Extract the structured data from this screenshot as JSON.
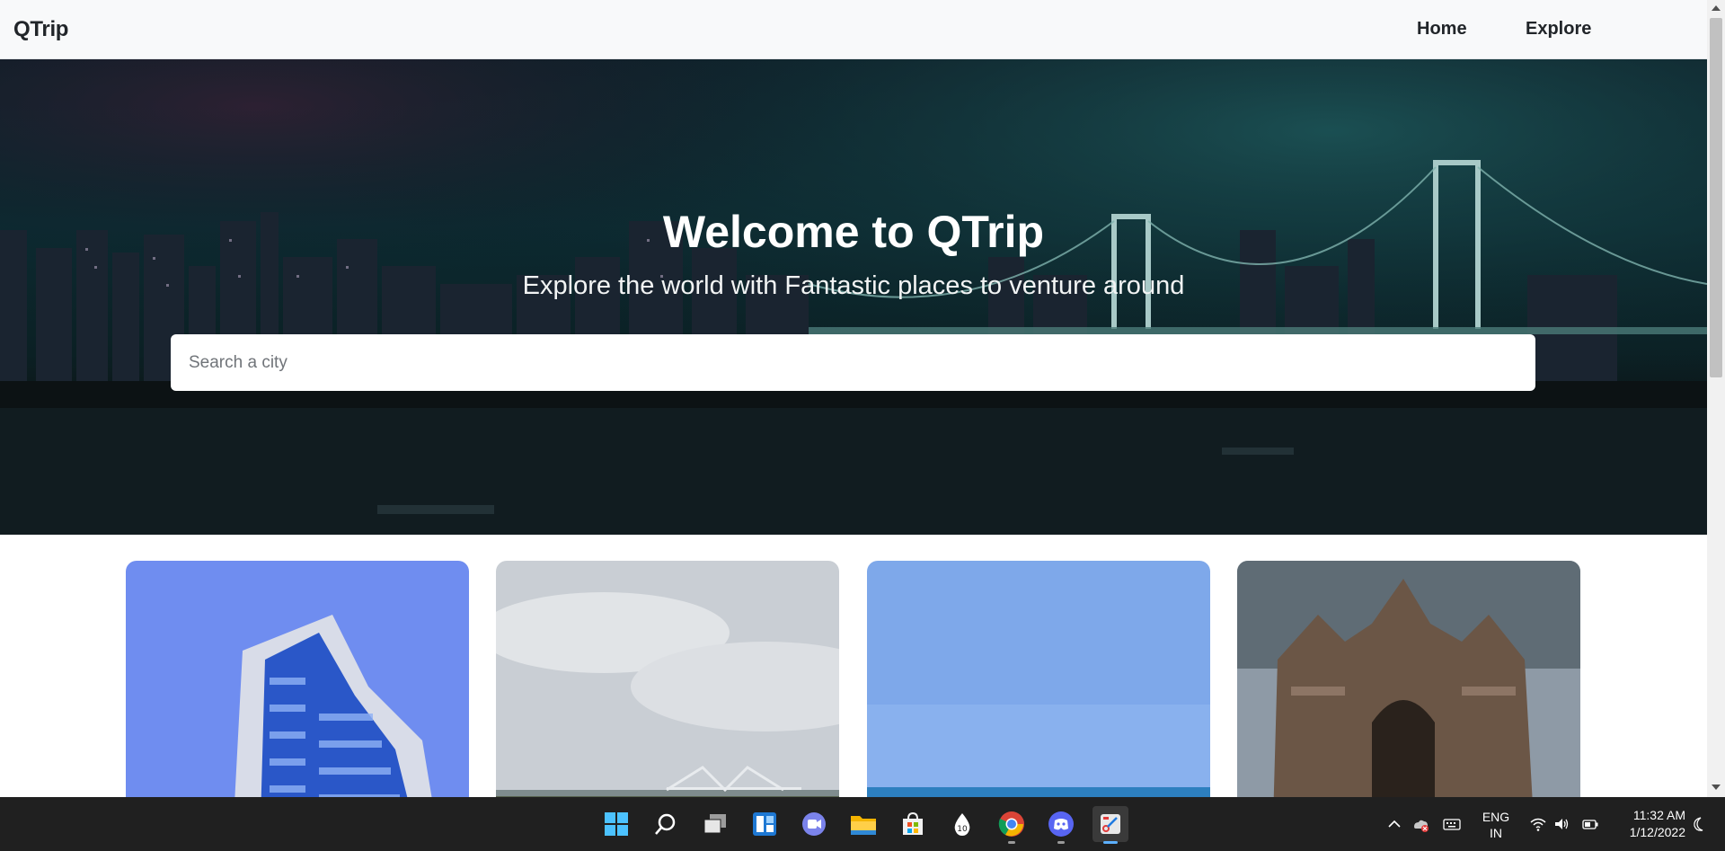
{
  "navbar": {
    "brand": "QTrip",
    "links": [
      "Home",
      "Explore"
    ]
  },
  "hero": {
    "title": "Welcome to QTrip",
    "subtitle": "Explore the world with Fantastic places to venture around",
    "search_placeholder": "Search a city"
  },
  "cards": [
    {
      "image": "glass-building-photo"
    },
    {
      "image": "bridge-river-photo"
    },
    {
      "image": "blue-sky-sea-photo"
    },
    {
      "image": "gateway-monument-photo"
    }
  ],
  "taskbar": {
    "apps": [
      "start-icon",
      "search-icon",
      "task-view-icon",
      "widgets-icon",
      "teams-chat-icon",
      "file-explorer-icon",
      "store-icon",
      "app-icon",
      "chrome-icon",
      "discord-icon",
      "snipping-tool-icon"
    ],
    "language_line1": "ENG",
    "language_line2": "IN",
    "time": "11:32 AM",
    "date": "1/12/2022"
  },
  "colors": {
    "navbar_bg": "#f8f9fa",
    "taskbar_bg": "#202020",
    "accent": "#5cb0ff"
  }
}
